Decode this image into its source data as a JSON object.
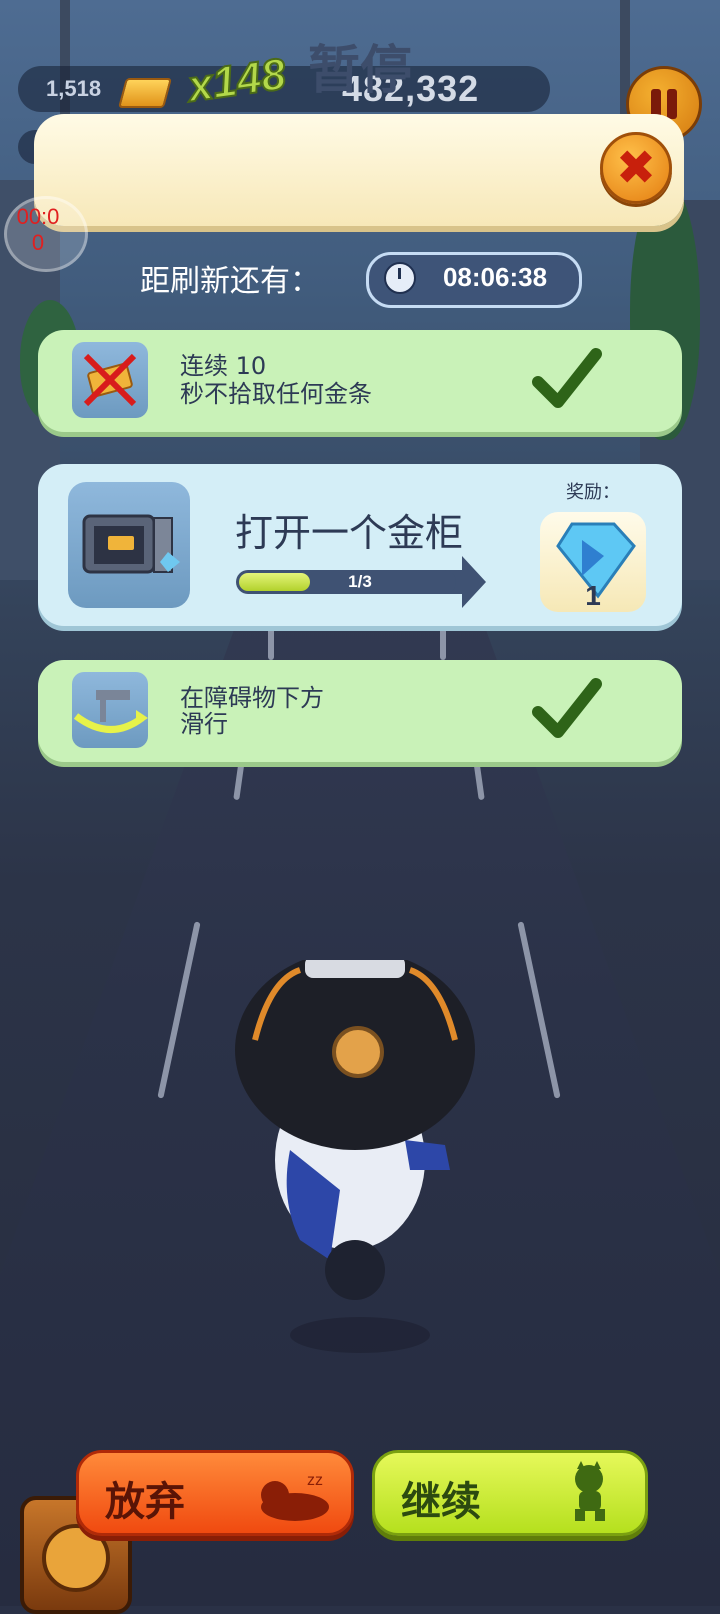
{
  "hud": {
    "gold_bars": "1,518",
    "multiplier": "x148",
    "score": "482,332"
  },
  "overlay": {
    "record_timer": "00:0\n0"
  },
  "pause_panel": {
    "title": "暂停",
    "refresh_label": "距刷新还有：",
    "refresh_timer": "08:06:38"
  },
  "missions": [
    {
      "line1": "连续 10",
      "line2": "秒不拾取任何金条",
      "status": "completed",
      "icon": "crossed-gold-icon"
    },
    {
      "title": "打开一个金柜",
      "progress_text": "1/3",
      "progress_fraction": 0.333,
      "reward_label": "奖励：",
      "reward_count": "1",
      "reward_icon": "diamond-icon",
      "icon": "vault-icon"
    },
    {
      "line1": "在障碍物下方",
      "line2": "滑行",
      "status": "completed",
      "icon": "slide-under-icon"
    }
  ],
  "buttons": {
    "quit": "放弃",
    "continue": "继续"
  },
  "colors": {
    "completed_card": "#c9f2b8",
    "active_card": "#d4eef7",
    "quit_button": "#f04a10",
    "continue_button": "#b5e01e"
  }
}
